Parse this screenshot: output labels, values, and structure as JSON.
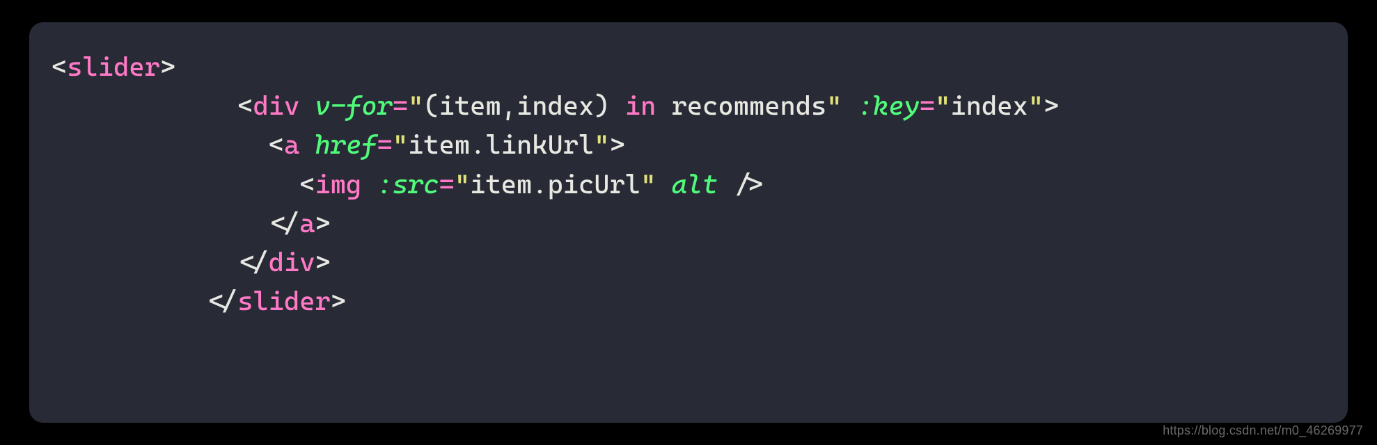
{
  "code": {
    "line1": {
      "lt": "<",
      "tag": "slider",
      "gt": ">"
    },
    "line2": {
      "indent": "            ",
      "lt": "<",
      "tag": "div",
      "sp1": " ",
      "attr_vfor": "v-for",
      "eq1": "=",
      "q1a": "\"",
      "val_vfor_a": "(item,index) ",
      "in": "in",
      "val_vfor_b": " recommends",
      "q1b": "\"",
      "sp2": " ",
      "attr_key": ":key",
      "eq2": "=",
      "q2a": "\"",
      "val_key": "index",
      "q2b": "\"",
      "gt": ">"
    },
    "line3": {
      "indent": "              ",
      "lt": "<",
      "tag": "a",
      "sp1": " ",
      "attr_href": "href",
      "eq1": "=",
      "q1a": "\"",
      "val_href": "item.linkUrl",
      "q1b": "\"",
      "gt": ">"
    },
    "line4": {
      "indent": "                ",
      "lt": "<",
      "tag": "img",
      "sp1": " ",
      "attr_src": ":src",
      "eq1": "=",
      "q1a": "\"",
      "val_src": "item.picUrl",
      "q1b": "\"",
      "sp2": " ",
      "attr_alt": "alt",
      "sp3": " ",
      "slashgt": "/>"
    },
    "line5": {
      "indent": "              ",
      "lt": "</",
      "tag": "a",
      "gt": ">"
    },
    "line6": {
      "indent": "            ",
      "lt": "</",
      "tag": "div",
      "gt": ">"
    },
    "line7": {
      "indent": "          ",
      "lt": "</",
      "tag": "slider",
      "gt": ">"
    }
  },
  "watermark": "https://blog.csdn.net/m0_46269977"
}
